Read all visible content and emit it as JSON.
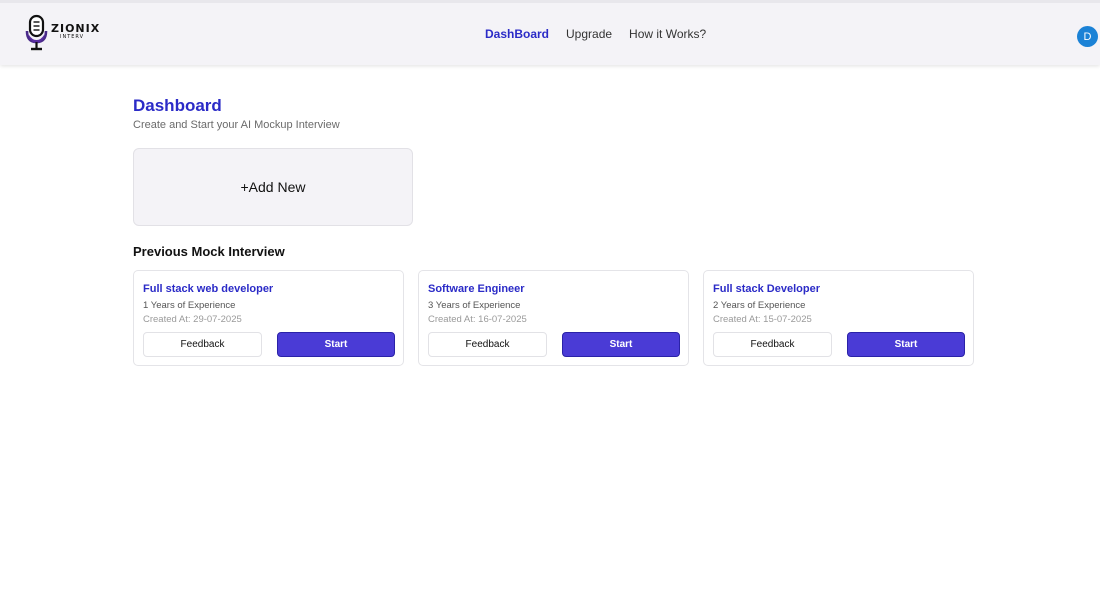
{
  "brand": {
    "logo_text": "ZIONIX",
    "logo_subtext": "INTERV",
    "logo_icon": "microphone-icon",
    "accent_color": "#2b2bc7",
    "button_color": "#4a3bd6"
  },
  "nav": {
    "items": [
      {
        "label": "DashBoard",
        "active": true
      },
      {
        "label": "Upgrade",
        "active": false
      },
      {
        "label": "How it Works?",
        "active": false
      }
    ]
  },
  "user": {
    "avatar_initial": "D",
    "avatar_color": "#1b82d6"
  },
  "main": {
    "title": "Dashboard",
    "subtitle": "Create and Start your AI Mockup Interview",
    "add_new_label": "+Add New",
    "section_title": "Previous Mock Interview"
  },
  "interviews": [
    {
      "title": "Full stack web developer",
      "experience": "1 Years of Experience",
      "created": "Created At: 29-07-2025",
      "feedback_label": "Feedback",
      "start_label": "Start"
    },
    {
      "title": "Software Engineer",
      "experience": "3 Years of Experience",
      "created": "Created At: 16-07-2025",
      "feedback_label": "Feedback",
      "start_label": "Start"
    },
    {
      "title": "Full stack Developer",
      "experience": "2 Years of Experience",
      "created": "Created At: 15-07-2025",
      "feedback_label": "Feedback",
      "start_label": "Start"
    }
  ]
}
